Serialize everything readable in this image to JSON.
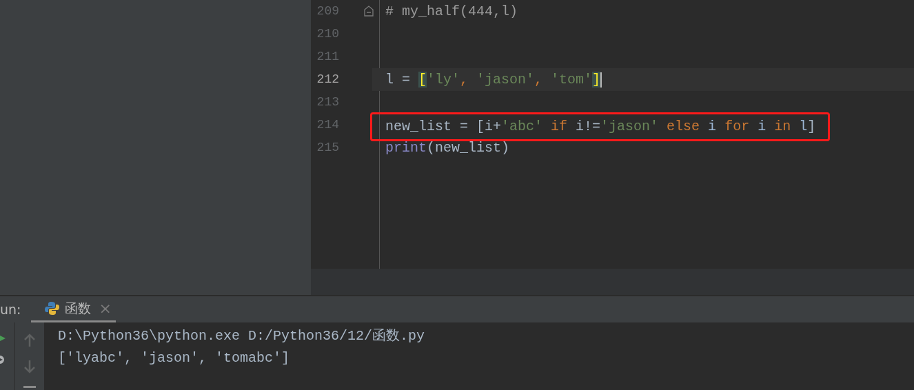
{
  "editor": {
    "lines": [
      {
        "number": "209",
        "current": false,
        "highlighted": false,
        "fold": true,
        "tokens": [
          {
            "text": "# my_half(444,l)",
            "kind": "comment"
          }
        ]
      },
      {
        "number": "210",
        "current": false,
        "highlighted": false,
        "fold": false
      },
      {
        "number": "211",
        "current": false,
        "highlighted": false,
        "fold": false
      },
      {
        "number": "212",
        "current": true,
        "highlighted": false,
        "fold": false,
        "tokens": [
          {
            "text": "l = ",
            "kind": "plain"
          },
          {
            "text": "[",
            "kind": "bracket-match"
          },
          {
            "text": "'ly'",
            "kind": "string"
          },
          {
            "text": ", ",
            "kind": "comma"
          },
          {
            "text": "'jason'",
            "kind": "string"
          },
          {
            "text": ", ",
            "kind": "comma"
          },
          {
            "text": "'tom'",
            "kind": "string"
          },
          {
            "text": "]",
            "kind": "bracket-match"
          }
        ]
      },
      {
        "number": "213",
        "current": false,
        "highlighted": false,
        "fold": false
      },
      {
        "number": "214",
        "current": false,
        "highlighted": true,
        "fold": false,
        "tokens": [
          {
            "text": "new_list = [i+",
            "kind": "plain"
          },
          {
            "text": "'abc'",
            "kind": "string"
          },
          {
            "text": " if",
            "kind": "keyword"
          },
          {
            "text": " i!=",
            "kind": "plain"
          },
          {
            "text": "'jason'",
            "kind": "string"
          },
          {
            "text": " else",
            "kind": "keyword"
          },
          {
            "text": " i",
            "kind": "local"
          },
          {
            "text": " for",
            "kind": "keyword"
          },
          {
            "text": " i",
            "kind": "local"
          },
          {
            "text": " in",
            "kind": "keyword"
          },
          {
            "text": " l",
            "kind": "local"
          },
          {
            "text": "]",
            "kind": "plain"
          }
        ]
      },
      {
        "number": "215",
        "current": false,
        "highlighted": false,
        "fold": false,
        "tokens": [
          {
            "text": "print",
            "kind": "builtin"
          },
          {
            "text": "(new_list)",
            "kind": "plain"
          }
        ]
      }
    ]
  },
  "run_panel": {
    "label": "un:",
    "tabs": [
      {
        "label": "函数",
        "selected": true,
        "close": "×"
      }
    ],
    "console": [
      "D:\\Python36\\python.exe D:/Python36/12/函数.py",
      "['lyabc', 'jason', 'tomabc']"
    ]
  }
}
